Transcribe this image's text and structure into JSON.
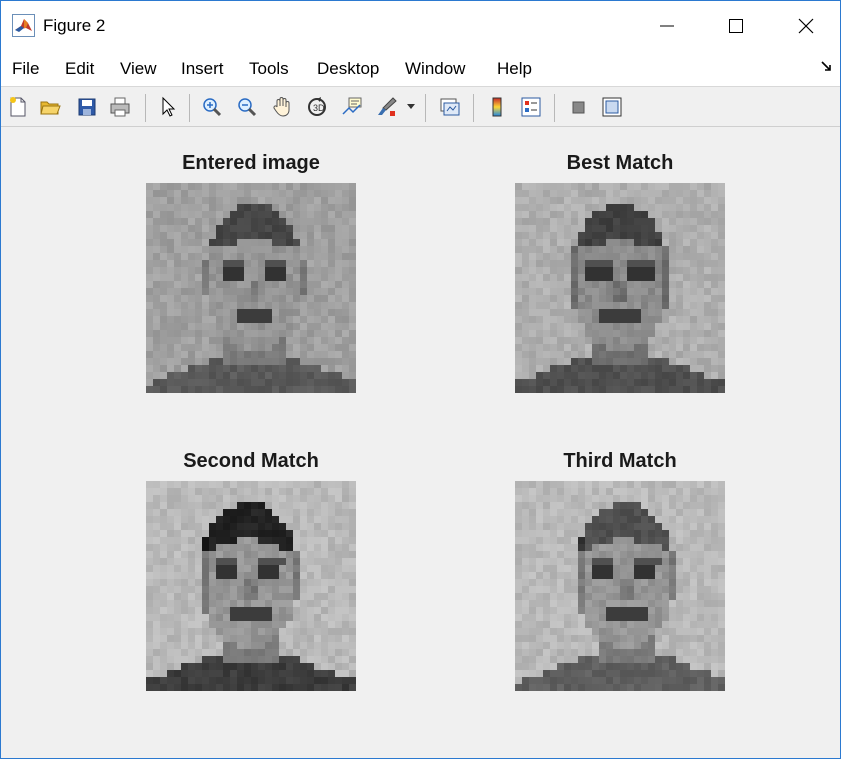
{
  "window": {
    "title": "Figure 2",
    "controls": [
      "minimize",
      "maximize",
      "close"
    ]
  },
  "menu": [
    "File",
    "Edit",
    "View",
    "Insert",
    "Tools",
    "Desktop",
    "Window",
    "Help"
  ],
  "toolbar": [
    "new-figure-icon",
    "open-file-icon",
    "save-icon",
    "print-icon",
    "pointer-icon",
    "zoom-in-icon",
    "zoom-out-icon",
    "pan-hand-icon",
    "rotate-3d-icon",
    "data-cursor-icon",
    "brush-icon",
    "link-plot-icon",
    "colorbar-icon",
    "legend-icon",
    "hide-plot-tools-icon",
    "show-plot-tools-icon"
  ],
  "panels": [
    {
      "title": "Entered image"
    },
    {
      "title": "Best Match"
    },
    {
      "title": "Second Match"
    },
    {
      "title": "Third Match"
    }
  ]
}
